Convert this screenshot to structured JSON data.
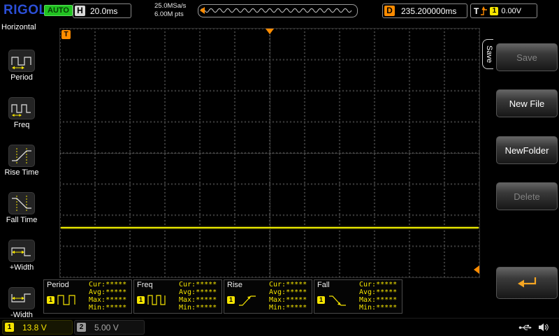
{
  "top_bar": {
    "logo": "RIGOL",
    "run_status": "AUTO",
    "horizontal": {
      "label": "H",
      "scale": "20.0ms"
    },
    "acquisition": {
      "sample_rate": "25.0MSa/s",
      "memory_depth": "6.00M pts"
    },
    "delay": {
      "label": "D",
      "value": "235.200000ms"
    },
    "trigger": {
      "label": "T",
      "source_badge": "1",
      "level": "0.00V"
    }
  },
  "left_menu": {
    "title": "Horizontal",
    "items": [
      {
        "label": "Period"
      },
      {
        "label": "Freq"
      },
      {
        "label": "Rise Time"
      },
      {
        "label": "Fall Time"
      },
      {
        "label": "+Width"
      },
      {
        "label": "-Width"
      }
    ]
  },
  "grid": {
    "trigger_corner_marker": "T"
  },
  "measurement_panels": [
    {
      "label": "Period",
      "channel": "1",
      "cur": "Cur:*****",
      "avg": "Avg:*****",
      "max": "Max:*****",
      "min": "Min:*****"
    },
    {
      "label": "Freq",
      "channel": "1",
      "cur": "Cur:*****",
      "avg": "Avg:*****",
      "max": "Max:*****",
      "min": "Min:*****"
    },
    {
      "label": "Rise",
      "channel": "1",
      "cur": "Cur:*****",
      "avg": "Avg:*****",
      "max": "Max:*****",
      "min": "Min:*****"
    },
    {
      "label": "Fall",
      "channel": "1",
      "cur": "Cur:*****",
      "avg": "Avg:*****",
      "max": "Max:*****",
      "min": "Min:*****"
    }
  ],
  "right_menu": {
    "tab_label": "Save",
    "buttons": [
      {
        "label": "Save",
        "enabled": false
      },
      {
        "label": "New File",
        "enabled": true
      },
      {
        "label": "NewFolder",
        "enabled": true
      },
      {
        "label": "Delete",
        "enabled": false
      }
    ],
    "enter_button_icon": "return-arrow"
  },
  "status_bar": {
    "channels": [
      {
        "badge": "1",
        "value": "13.8 V",
        "active": true
      },
      {
        "badge": "2",
        "value": "5.00 V",
        "active": false
      }
    ],
    "icons": [
      "usb-plug",
      "speaker"
    ]
  },
  "colors": {
    "channel1_yellow": "#f5e400",
    "channel2_gray": "#9a9a9a",
    "trigger_orange": "#ff8c00",
    "run_status_green": "#21c321",
    "logo_blue": "#2b4fd7",
    "trace_yellow": "#e8e800"
  }
}
